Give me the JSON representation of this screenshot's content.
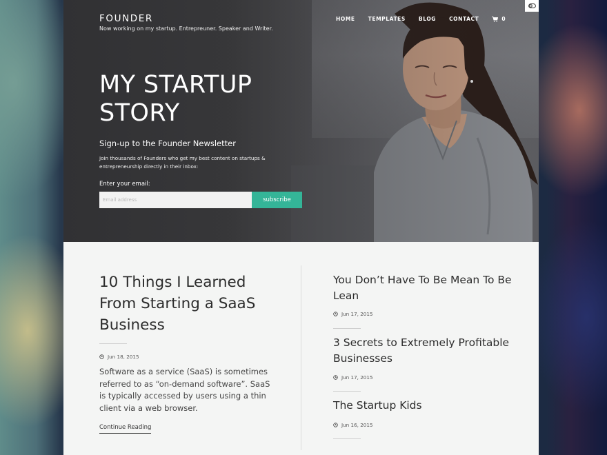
{
  "site": {
    "brand": "FOUNDER",
    "tagline": "Now working on my startup. Entrepreuner. Speaker and Writer."
  },
  "nav": {
    "items": [
      "HOME",
      "TEMPLATES",
      "BLOG",
      "CONTACT"
    ],
    "cart_count": "0"
  },
  "hero": {
    "title": "MY STARTUP STORY",
    "signup_title": "Sign-up to the Founder Newsletter",
    "signup_desc": "Join thousands of Founders who get my best content on startups & entrepreneurship directly in their inbox:",
    "email_label": "Enter your email:",
    "email_placeholder": "Email address",
    "email_value": "",
    "subscribe_label": "subscribe"
  },
  "featured_post": {
    "title": "10 Things I Learned From Starting a SaaS Business",
    "date": "Jun 18, 2015",
    "excerpt": "Software as a service (SaaS) is sometimes referred to as “on-demand software”. SaaS is typically accessed by users using a thin client via a web browser.",
    "continue_label": "Continue Reading"
  },
  "posts": [
    {
      "title": "You Don’t Have To Be Mean To Be Lean",
      "date": "Jun 17, 2015"
    },
    {
      "title": "3 Secrets to Extremely Profitable Businesses",
      "date": "Jun 17, 2015"
    },
    {
      "title": "The Startup Kids",
      "date": "Jun 16, 2015"
    }
  ],
  "colors": {
    "accent": "#34b598",
    "page_bg": "#f4f5f4",
    "text": "#2c2c2c"
  },
  "icons": {
    "cart": "cart-icon",
    "clock": "clock-icon",
    "toggle": "toggle-icon"
  }
}
